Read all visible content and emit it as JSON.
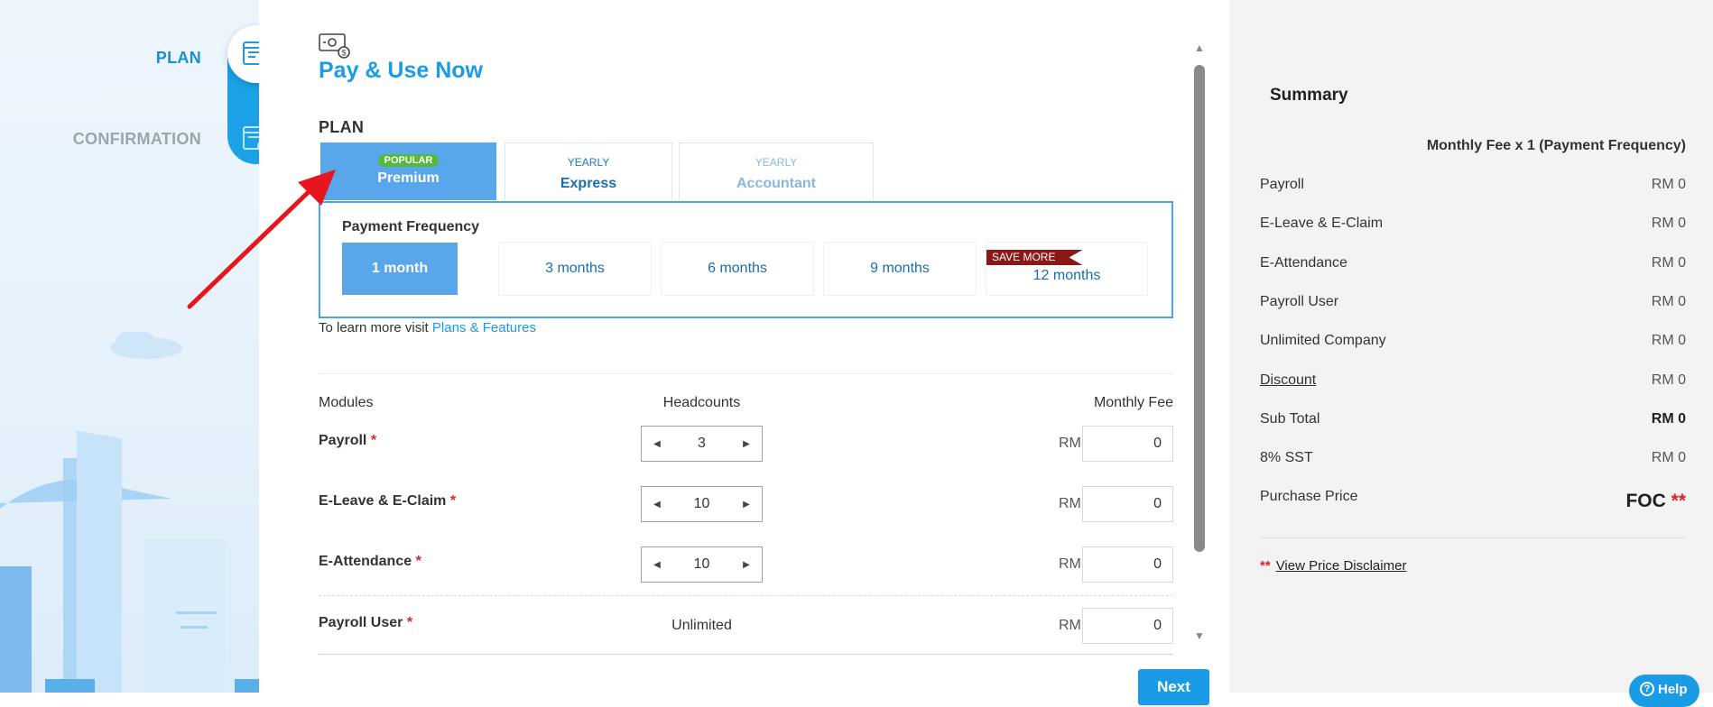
{
  "sidebar": {
    "steps": [
      {
        "label": "PLAN"
      },
      {
        "label": "CONFIRMATION"
      }
    ]
  },
  "main": {
    "title": "Pay & Use Now",
    "plan_heading": "PLAN",
    "plans": [
      {
        "tag": "POPULAR",
        "name": "Premium"
      },
      {
        "tag": "YEARLY",
        "name": "Express"
      },
      {
        "tag": "YEARLY",
        "name": "Accountant"
      }
    ],
    "frequency": {
      "label": "Payment Frequency",
      "options": [
        "1 month",
        "3 months",
        "6 months",
        "9 months",
        "12 months"
      ],
      "selected": "1 month",
      "save_badge": "SAVE MORE"
    },
    "learn_more": {
      "text": "To learn more visit",
      "link": "Plans & Features"
    },
    "columns": {
      "modules": "Modules",
      "headcounts": "Headcounts",
      "monthly_fee": "Monthly Fee"
    },
    "modules": [
      {
        "name": "Payroll",
        "required": "*",
        "headcount": "3",
        "currency": "RM",
        "fee": "0"
      },
      {
        "name": "E-Leave & E-Claim",
        "required": "*",
        "headcount": "10",
        "currency": "RM",
        "fee": "0"
      },
      {
        "name": "E-Attendance",
        "required": "*",
        "headcount": "10",
        "currency": "RM",
        "fee": "0"
      },
      {
        "name": "Payroll User",
        "required": "*",
        "headcount": "Unlimited",
        "currency": "RM",
        "fee": "0"
      }
    ],
    "next_label": "Next"
  },
  "summary": {
    "title": "Summary",
    "frequency_note": "Monthly Fee x 1 (Payment Frequency)",
    "rows": [
      {
        "label": "Payroll",
        "value": "RM 0"
      },
      {
        "label": "E-Leave & E-Claim",
        "value": "RM 0"
      },
      {
        "label": "E-Attendance",
        "value": "RM 0"
      },
      {
        "label": "Payroll User",
        "value": "RM 0"
      },
      {
        "label": "Unlimited Company",
        "value": "RM 0"
      },
      {
        "label": "Discount",
        "value": "RM 0"
      },
      {
        "label": "Sub Total",
        "value": "RM 0"
      },
      {
        "label": "8% SST",
        "value": "RM 0"
      },
      {
        "label": "Purchase Price",
        "value": ""
      }
    ],
    "purchase_price": "FOC",
    "purchase_stars": "**",
    "disclaimer_stars": "**",
    "disclaimer_link": "View Price Disclaimer",
    "help_label": "Help"
  },
  "colors": {
    "accent": "#1a9be6",
    "tab_active": "#5aa6ea",
    "popular": "#55b93a",
    "save_ribbon": "#8d1717",
    "required": "#e0202a"
  }
}
